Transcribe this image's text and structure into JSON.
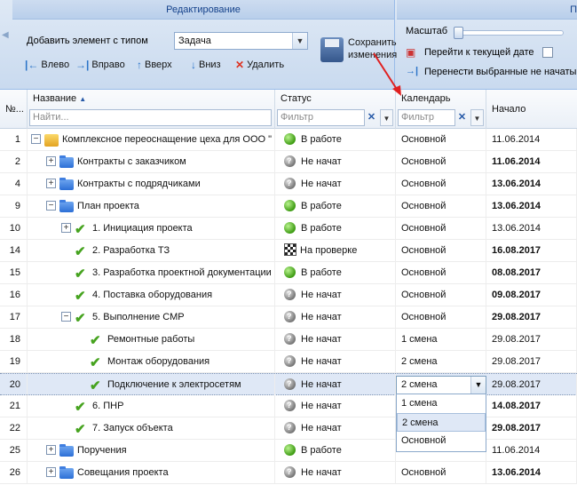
{
  "toolbar": {
    "edit_group_title": "Редактирование",
    "add_type_label": "Добавить элемент с типом",
    "add_type_value": "Задача",
    "save_label_line1": "Сохранить",
    "save_label_line2": "изменения",
    "btn_left": "Влево",
    "btn_right": "Вправо",
    "btn_up": "Вверх",
    "btn_down": "Вниз",
    "btn_delete": "Удалить",
    "scale_label": "Масштаб",
    "goto_current": "Перейти к текущей дате",
    "move_unstarted": "Перенести выбранные не начатые",
    "scale_group_title_partial": "П"
  },
  "columns": {
    "num": "№...",
    "name": "Название",
    "status": "Статус",
    "calendar": "Календарь",
    "start": "Начало",
    "name_filter_placeholder": "Найти...",
    "status_filter_placeholder": "Фильтр",
    "calendar_filter_placeholder": "Фильтр"
  },
  "rows": [
    {
      "num": "1",
      "name": "Комплексное переоснащение цеха для ООО \"",
      "status": "В работе",
      "calendar": "Основной",
      "start": "11.06.2014"
    },
    {
      "num": "2",
      "name": "Контракты с заказчиком",
      "status": "Не начат",
      "calendar": "Основной",
      "start": "11.06.2014"
    },
    {
      "num": "4",
      "name": "Контракты с подрядчиками",
      "status": "Не начат",
      "calendar": "Основной",
      "start": "13.06.2014"
    },
    {
      "num": "9",
      "name": "План проекта",
      "status": "В работе",
      "calendar": "Основной",
      "start": "13.06.2014"
    },
    {
      "num": "10",
      "name": "1. Инициация проекта",
      "status": "В работе",
      "calendar": "Основной",
      "start": "13.06.2014"
    },
    {
      "num": "14",
      "name": "2. Разработка ТЗ",
      "status": "На проверке",
      "calendar": "Основной",
      "start": "16.08.2017"
    },
    {
      "num": "15",
      "name": "3. Разработка проектной документации",
      "status": "В работе",
      "calendar": "Основной",
      "start": "08.08.2017"
    },
    {
      "num": "16",
      "name": "4. Поставка оборудования",
      "status": "Не начат",
      "calendar": "Основной",
      "start": "09.08.2017"
    },
    {
      "num": "17",
      "name": "5. Выполнение СМР",
      "status": "Не начат",
      "calendar": "Основной",
      "start": "29.08.2017"
    },
    {
      "num": "18",
      "name": "Ремонтные работы",
      "status": "Не начат",
      "calendar": "1 смена",
      "start": "29.08.2017"
    },
    {
      "num": "19",
      "name": "Монтаж оборудования",
      "status": "Не начат",
      "calendar": "2 смена",
      "start": "29.08.2017"
    },
    {
      "num": "20",
      "name": "Подключение к электросетям",
      "status": "Не начат",
      "calendar": "2 смена",
      "start": "29.08.2017"
    },
    {
      "num": "21",
      "name": "6. ПНР",
      "status": "Не начат",
      "calendar": "",
      "start": "14.08.2017"
    },
    {
      "num": "22",
      "name": "7. Запуск объекта",
      "status": "Не начат",
      "calendar": "",
      "start": "29.08.2017"
    },
    {
      "num": "25",
      "name": "Поручения",
      "status": "В работе",
      "calendar": "",
      "start": "11.06.2014"
    },
    {
      "num": "26",
      "name": "Совещания проекта",
      "status": "Не начат",
      "calendar": "Основной",
      "start": "13.06.2014"
    }
  ],
  "dropdown_options": [
    "1 смена",
    "2 смена",
    "Основной"
  ],
  "dropdown_selected": "2 смена",
  "colors": {
    "header_bg": "#dfe9f5",
    "selected_row": "#dfe8f6",
    "accent": "#15428b",
    "arrow": "#e02020"
  }
}
